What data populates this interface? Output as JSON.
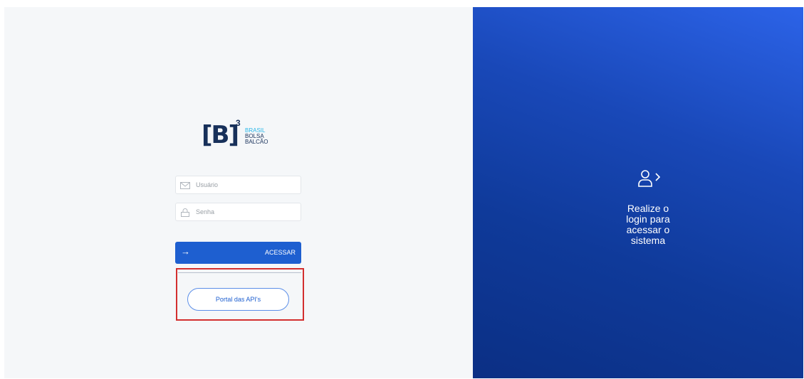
{
  "logo": {
    "brand": "[B]",
    "superscript": "3",
    "lines": [
      "BRASIL",
      "BOLSA",
      "BALCÃO"
    ]
  },
  "form": {
    "username": {
      "placeholder": "Usuário",
      "value": "",
      "icon": "mail-icon"
    },
    "password": {
      "placeholder": "Senha",
      "value": "",
      "icon": "lock-icon"
    },
    "submit": {
      "label": "ACESSAR",
      "arrow": "→"
    },
    "portal_button": {
      "label": "Portal das API's"
    }
  },
  "side_panel": {
    "icon": "user-login-icon",
    "message_lines": [
      "Realize o",
      "login para",
      "acessar o",
      "sistema"
    ]
  },
  "colors": {
    "primary": "#1e5fd0",
    "highlight_border": "#d32f2f",
    "panel_gradient_top": "#2c63e8",
    "panel_gradient_bottom": "#0b2f84"
  }
}
